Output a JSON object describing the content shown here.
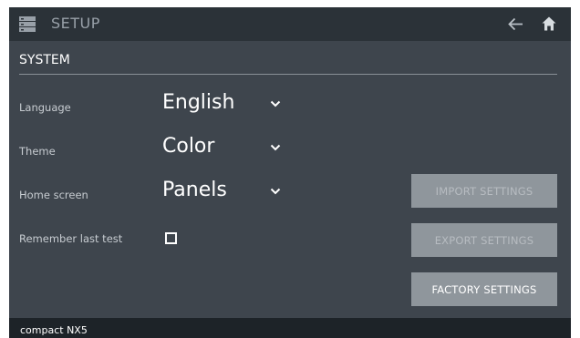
{
  "header": {
    "title": "SETUP",
    "menu_icon": "storage-menu-icon",
    "back_icon": "arrow-left-icon",
    "home_icon": "home-icon"
  },
  "section": {
    "title": "SYSTEM"
  },
  "settings": {
    "language": {
      "label": "Language",
      "value": "English"
    },
    "theme": {
      "label": "Theme",
      "value": "Color"
    },
    "home_screen": {
      "label": "Home screen",
      "value": "Panels"
    },
    "remember_last_test": {
      "label": "Remember last test",
      "checked": false
    }
  },
  "actions": {
    "import_label": "IMPORT SETTINGS",
    "export_label": "EXPORT SETTINGS",
    "factory_label": "FACTORY SETTINGS"
  },
  "status": {
    "device": "compact NX5"
  },
  "colors": {
    "background": "#3e454d",
    "topbar": "#2b3238",
    "statusbar": "#1d2328",
    "button": "#8f969c"
  }
}
